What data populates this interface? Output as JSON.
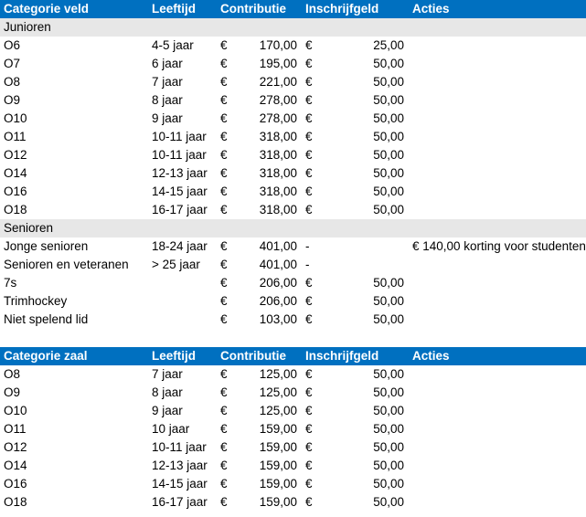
{
  "tables": [
    {
      "headers": [
        "Categorie veld",
        "Leeftijd",
        "Contributie",
        "Inschrijfgeld",
        "Acties"
      ],
      "sections": [
        {
          "title": "Junioren",
          "rows": [
            [
              "O6",
              "4-5 jaar",
              "€",
              "170,00",
              "€",
              "25,00",
              ""
            ],
            [
              "O7",
              "6 jaar",
              "€",
              "195,00",
              "€",
              "50,00",
              ""
            ],
            [
              "O8",
              "7 jaar",
              "€",
              "221,00",
              "€",
              "50,00",
              ""
            ],
            [
              "O9",
              "8 jaar",
              "€",
              "278,00",
              "€",
              "50,00",
              ""
            ],
            [
              "O10",
              "9 jaar",
              "€",
              "278,00",
              "€",
              "50,00",
              ""
            ],
            [
              "O11",
              "10-11 jaar",
              "€",
              "318,00",
              "€",
              "50,00",
              ""
            ],
            [
              "O12",
              "10-11 jaar",
              "€",
              "318,00",
              "€",
              "50,00",
              ""
            ],
            [
              "O14",
              "12-13 jaar",
              "€",
              "318,00",
              "€",
              "50,00",
              ""
            ],
            [
              "O16",
              "14-15 jaar",
              "€",
              "318,00",
              "€",
              "50,00",
              ""
            ],
            [
              "O18",
              "16-17 jaar",
              "€",
              "318,00",
              "€",
              "50,00",
              ""
            ]
          ]
        },
        {
          "title": "Senioren",
          "rows": [
            [
              "Jonge senioren",
              "18-24 jaar",
              "€",
              "401,00",
              "-",
              "",
              "€ 140,00 korting voor studenten"
            ],
            [
              "Senioren en veteranen",
              "> 25 jaar",
              "€",
              "401,00",
              "-",
              "",
              ""
            ],
            [
              "7s",
              "",
              "€",
              "206,00",
              "€",
              "50,00",
              ""
            ],
            [
              "Trimhockey",
              "",
              "€",
              "206,00",
              "€",
              "50,00",
              ""
            ],
            [
              "Niet spelend lid",
              "",
              "€",
              "103,00",
              "€",
              "50,00",
              ""
            ]
          ]
        }
      ]
    },
    {
      "headers": [
        "Categorie zaal",
        "Leeftijd",
        "Contributie",
        "Inschrijfgeld",
        "Acties"
      ],
      "sections": [
        {
          "title": null,
          "rows": [
            [
              "O8",
              "7 jaar",
              "€",
              "125,00",
              "€",
              "50,00",
              ""
            ],
            [
              "O9",
              "8 jaar",
              "€",
              "125,00",
              "€",
              "50,00",
              ""
            ],
            [
              "O10",
              "9 jaar",
              "€",
              "125,00",
              "€",
              "50,00",
              ""
            ],
            [
              "O11",
              "10 jaar",
              "€",
              "159,00",
              "€",
              "50,00",
              ""
            ],
            [
              "O12",
              "10-11 jaar",
              "€",
              "159,00",
              "€",
              "50,00",
              ""
            ],
            [
              "O14",
              "12-13 jaar",
              "€",
              "159,00",
              "€",
              "50,00",
              ""
            ],
            [
              "O16",
              "14-15 jaar",
              "€",
              "159,00",
              "€",
              "50,00",
              ""
            ],
            [
              "O18",
              "16-17 jaar",
              "€",
              "159,00",
              "€",
              "50,00",
              ""
            ]
          ]
        }
      ]
    }
  ]
}
